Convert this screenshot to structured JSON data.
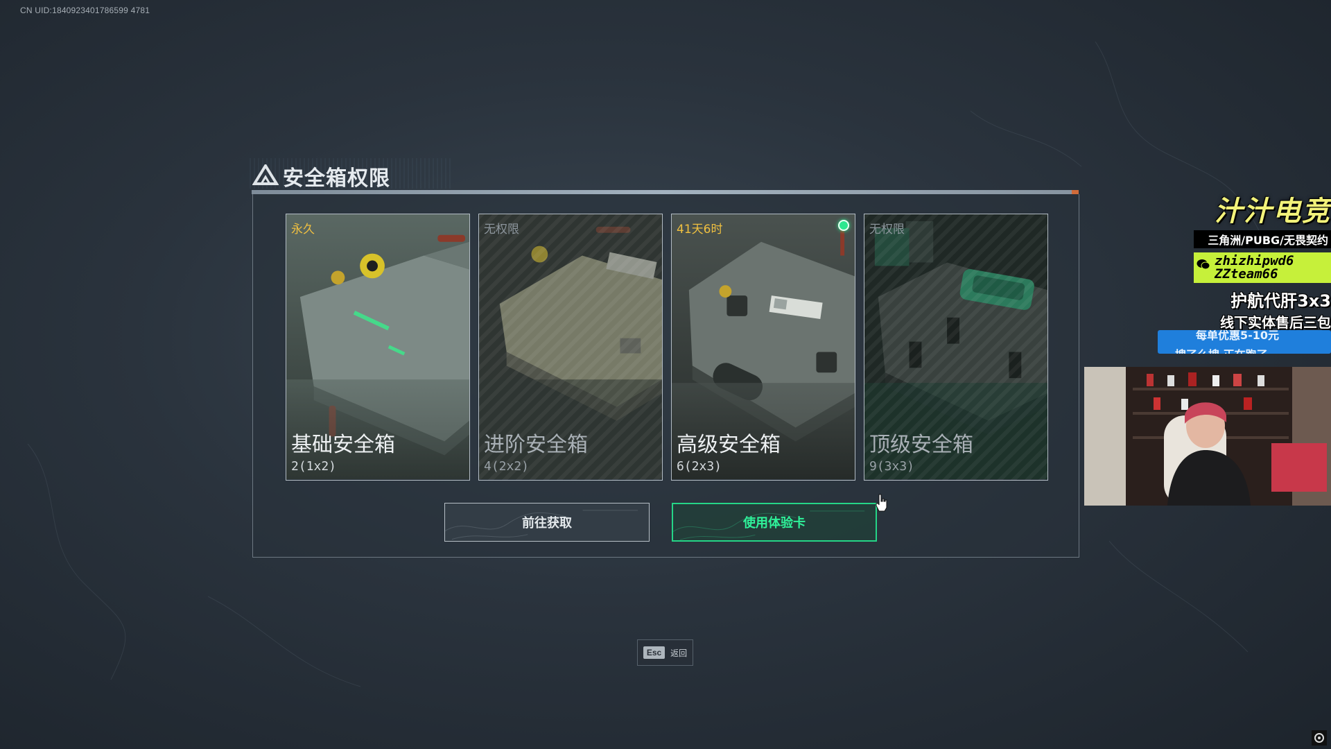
{
  "uid": "CN UID:1840923401786599 4781",
  "dialog": {
    "title": "安全箱权限",
    "cards": [
      {
        "status": "永久",
        "status_color": "gold",
        "name": "基础安全箱",
        "size": "2(1x2)",
        "locked": false,
        "selected": false
      },
      {
        "status": "无权限",
        "status_color": "gray",
        "name": "进阶安全箱",
        "size": "4(2x2)",
        "locked": true,
        "selected": false
      },
      {
        "status": "41天6时",
        "status_color": "gold",
        "name": "高级安全箱",
        "size": "6(2x3)",
        "locked": false,
        "selected": true
      },
      {
        "status": "无权限",
        "status_color": "gray",
        "name": "顶级安全箱",
        "size": "9(3x3)",
        "locked": true,
        "selected": false
      }
    ],
    "buttons": {
      "obtain": "前往获取",
      "use_trial": "使用体验卡"
    }
  },
  "esc_hint": {
    "key": "Esc",
    "label": "返回"
  },
  "overlay": {
    "brand": "汁汁电竞",
    "games": "三角洲/PUBG/无畏契约",
    "wechat_ids": [
      "zhizhipwd6",
      "ZZteam66"
    ],
    "line1": "护航代肝3x3",
    "line2": "线下实体售后三包",
    "banner_fragment_1": "每单优惠5-10元",
    "banner_fragment_2": "搜了么搜 正在跑了"
  },
  "colors": {
    "accent_green": "#25d587",
    "status_gold": "#f0c040",
    "ad_yellow": "#f2f27a",
    "ad_lime": "#c6f03a",
    "banner_blue": "#1f7fdc"
  },
  "icons": [
    "delta-logo-icon",
    "active-indicator-icon",
    "wechat-icon",
    "hand-cursor-icon",
    "settings-corner-icon"
  ]
}
